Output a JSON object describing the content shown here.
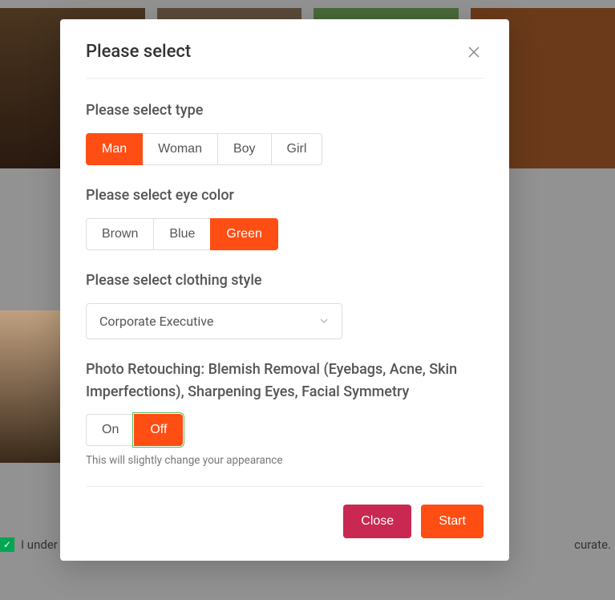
{
  "modal": {
    "title": "Please select",
    "type_section": {
      "label": "Please select type",
      "options": [
        "Man",
        "Woman",
        "Boy",
        "Girl"
      ],
      "selected": "Man"
    },
    "eye_section": {
      "label": "Please select eye color",
      "options": [
        "Brown",
        "Blue",
        "Green"
      ],
      "selected": "Green"
    },
    "clothing_section": {
      "label": "Please select clothing style",
      "selected_value": "Corporate Executive"
    },
    "retouch_section": {
      "label": "Photo Retouching: Blemish Removal (Eyebags, Acne, Skin Imperfections), Sharpening Eyes, Facial Symmetry",
      "options": [
        "On",
        "Off"
      ],
      "selected": "Off",
      "helper": "This will slightly change your appearance"
    },
    "footer": {
      "close_label": "Close",
      "start_label": "Start"
    }
  },
  "background": {
    "consent_prefix": "I under",
    "consent_suffix": "curate."
  }
}
